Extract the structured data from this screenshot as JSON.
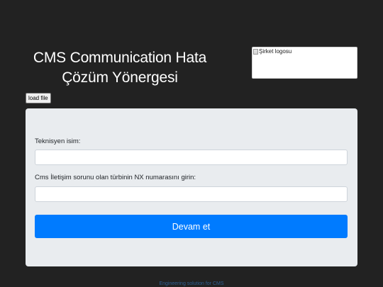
{
  "header": {
    "title": "CMS Communication Hata Çözüm Yönergesi",
    "logo_alt": "Şirket logosu"
  },
  "toolbar": {
    "load_file_label": "load file"
  },
  "form": {
    "technician_label": "Teknisyen isim:",
    "technician_value": "",
    "turbine_label": "Cms İletişim sorunu olan türbinin NX numarasını girin:",
    "turbine_value": "",
    "submit_label": "Devam et"
  },
  "footer": {
    "text": "Engineering solution for CMS"
  },
  "colors": {
    "background": "#222222",
    "card": "#e9ecef",
    "primary_button": "#007bff"
  }
}
